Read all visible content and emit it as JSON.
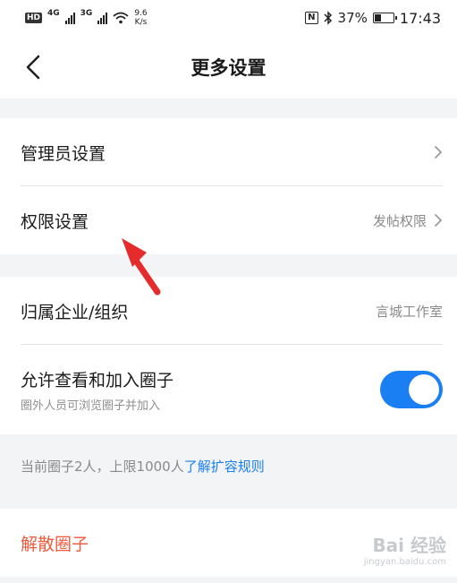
{
  "status_bar": {
    "hd": "HD",
    "net1": "4G",
    "net2": "3G",
    "speed_value": "9.6",
    "speed_unit": "K/s",
    "nfc": "N",
    "battery_percent": "37%",
    "battery_level": 0.37,
    "time": "17:43",
    "icons": [
      "hd-icon",
      "signal-icon",
      "wifi-icon",
      "nfc-icon",
      "bluetooth-icon",
      "battery-icon"
    ]
  },
  "nav": {
    "title": "更多设置",
    "back_icon": "chevron-left-icon"
  },
  "section1": {
    "admin_label": "管理员设置",
    "permission_label": "权限设置",
    "permission_value": "发帖权限"
  },
  "section2": {
    "org_label": "归属企业/组织",
    "org_value": "言城工作室",
    "allow_label": "允许查看和加入圈子",
    "allow_sub": "圈外人员可浏览圈子并加入",
    "allow_enabled": true
  },
  "info": {
    "text": "当前圈子2人，上限1000人",
    "link": "了解扩容规则"
  },
  "danger": {
    "label": "解散圈子"
  },
  "watermark": {
    "logo": "Bai 经验",
    "sub": "jingyan.baidu.com"
  },
  "colors": {
    "accent": "#1a7ff2",
    "danger": "#ef5a3c",
    "annotation": "#e52b2b"
  }
}
